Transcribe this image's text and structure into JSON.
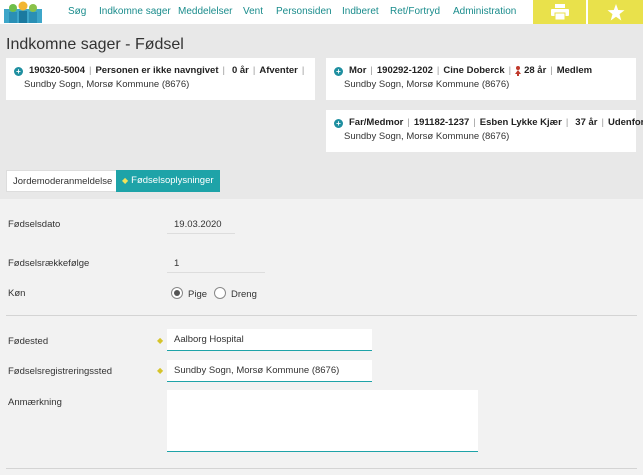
{
  "nav": {
    "items": [
      "Søg",
      "Indkomne sager",
      "Meddelelser",
      "Vent",
      "Personsiden",
      "Indberet",
      "Ret/Fortryd",
      "Administration"
    ],
    "print_icon": "printer-icon",
    "favorite_icon": "star-icon"
  },
  "page": {
    "title": "Indkomne sager - Fødsel"
  },
  "child_card": {
    "cpr": "190320-5004",
    "name": "Personen er ikke navngivet",
    "age": "0 år",
    "status": "Afventer",
    "location": "Sundby Sogn, Morsø Kommune (8676)"
  },
  "mother_card": {
    "role": "Mor",
    "cpr": "190292-1202",
    "name": "Cine Doberck",
    "age": "28 år",
    "status": "Medlem",
    "location": "Sundby Sogn, Morsø Kommune (8676)"
  },
  "father_card": {
    "role": "Far/Medmor",
    "cpr": "191182-1237",
    "name": "Esben Lykke Kjær",
    "age": "37 år",
    "status": "Udenfor",
    "location": "Sundby Sogn, Morsø Kommune (8676)"
  },
  "tabs": {
    "midwife": "Jordemoderanmeldelse",
    "birth_info": "Fødselsoplysninger"
  },
  "form": {
    "birth_date_label": "Fødselsdato",
    "birth_date": "19.03.2020",
    "birth_order_label": "Fødselsrækkefølge",
    "birth_order": "1",
    "gender_label": "Køn",
    "gender_options": [
      "Pige",
      "Dreng"
    ],
    "gender_selected": "Pige",
    "birthplace_label": "Fødested",
    "birthplace": "Aalborg Hospital",
    "registration_label": "Fødselsregistreringssted",
    "registration_place": "Sundby Sogn, Morsø Kommune (8676)",
    "remark_label": "Anmærkning",
    "remark": ""
  },
  "colors": {
    "accent": "#1ea3a8",
    "topbar_button": "#e9e14b",
    "female": "#c0392b",
    "male": "#1f8fa0"
  }
}
